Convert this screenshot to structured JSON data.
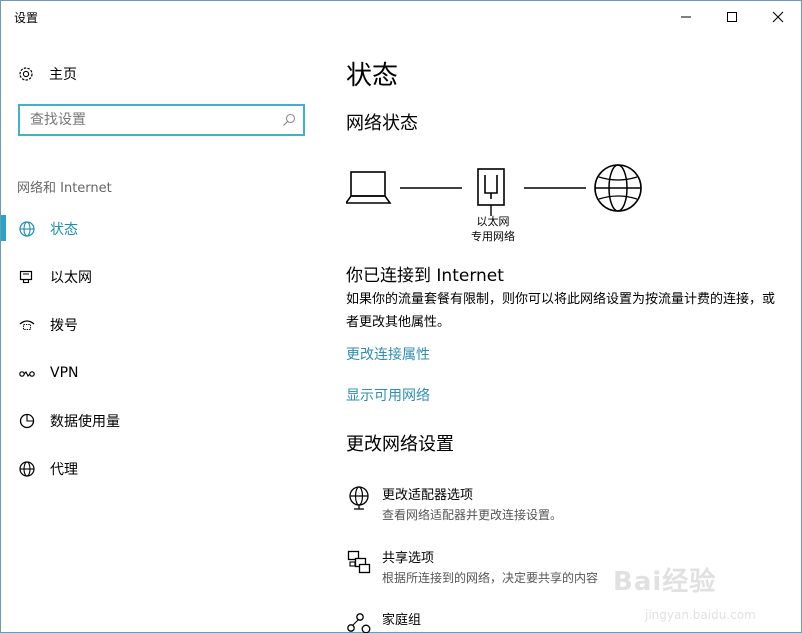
{
  "window": {
    "title": "设置"
  },
  "sidebar": {
    "home_label": "主页",
    "search_placeholder": "查找设置",
    "group_title": "网络和 Internet",
    "items": [
      {
        "label": "状态",
        "icon": "globe-icon",
        "active": true
      },
      {
        "label": "以太网",
        "icon": "ethernet-icon",
        "active": false
      },
      {
        "label": "拨号",
        "icon": "dialup-icon",
        "active": false
      },
      {
        "label": "VPN",
        "icon": "vpn-icon",
        "active": false
      },
      {
        "label": "数据使用量",
        "icon": "data-usage-icon",
        "active": false
      },
      {
        "label": "代理",
        "icon": "proxy-globe-icon",
        "active": false
      }
    ]
  },
  "main": {
    "page_title": "状态",
    "network_status_heading": "网络状态",
    "diagram": {
      "adapter_label_line1": "以太网",
      "adapter_label_line2": "专用网络"
    },
    "connected_text": "你已连接到 Internet",
    "description": "如果你的流量套餐有限制，则你可以将此网络设置为按流量计费的连接，或者更改其他属性。",
    "link_change_properties": "更改连接属性",
    "link_show_networks": "显示可用网络",
    "change_settings_heading": "更改网络设置",
    "options": [
      {
        "title": "更改适配器选项",
        "subtitle": "查看网络适配器并更改连接设置。"
      },
      {
        "title": "共享选项",
        "subtitle": "根据所连接到的网络，决定要共享的内容"
      },
      {
        "title": "家庭组",
        "subtitle": ""
      }
    ]
  },
  "watermark": {
    "brand": "Bai经验",
    "url": "jingyan.baidu.com"
  },
  "colors": {
    "accent": "#41b1c9",
    "link": "#2d8fb3",
    "active_nav": "#1b8fb0"
  }
}
